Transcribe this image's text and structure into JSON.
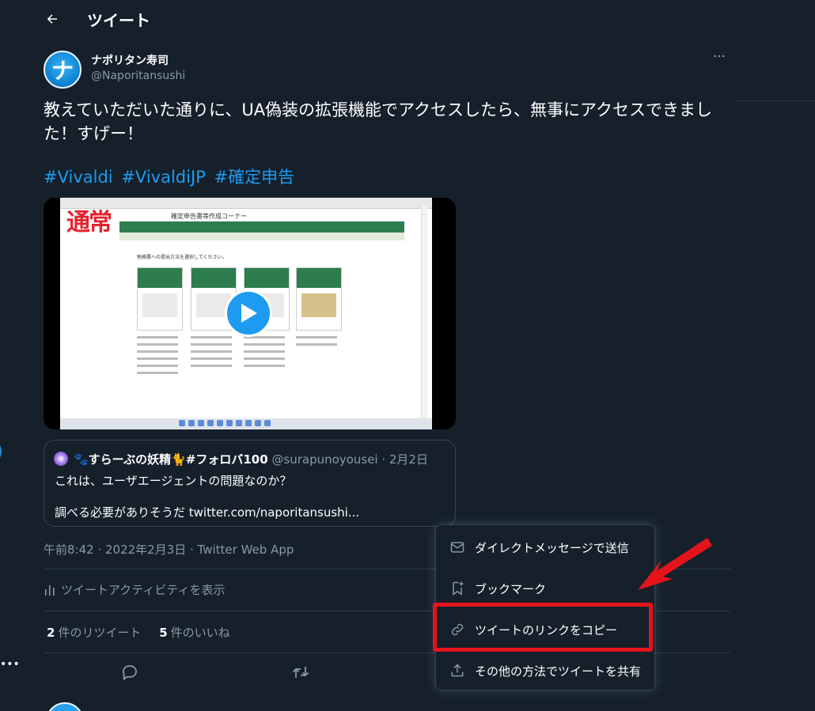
{
  "header": {
    "title": "ツイート",
    "back_icon": "arrow-left-icon"
  },
  "author": {
    "avatar_letter": "ナ",
    "name": "ナポリタン寿司",
    "handle": "@Naporitansushi"
  },
  "tweet": {
    "text": "教えていただいた通りに、UA偽装の拡張機能でアクセスしたら、無事にアクセスできました！すげー！",
    "hashtags": [
      "#Vivaldi",
      "#VivaldiJP",
      "#確定申告"
    ],
    "media_overlay_text": "通常",
    "media_header_title": "確定申告書等作成コーナー",
    "media_section_label": "税務署への提出方法を選択してください。"
  },
  "quote": {
    "name": "🐾すらーぶの妖精🐈#フォロバ100",
    "handle_date": "@surapunoyousei · 2月2日",
    "line1": "これは、ユーザエージェントの問題なのか？",
    "line2": "調べる必要がありそうだ twitter.com/naporitansushi..."
  },
  "meta": {
    "timestamp": "午前8:42 · 2022年2月3日 · Twitter Web App",
    "activity": "ツイートアクティビティを表示",
    "retweets_count": "2",
    "retweets_label": "件のリツイート",
    "likes_count": "5",
    "likes_label": "件のいいね"
  },
  "menu": {
    "items": [
      {
        "label": "ダイレクトメッセージで送信",
        "icon": "envelope-icon"
      },
      {
        "label": "ブックマーク",
        "icon": "bookmark-add-icon"
      },
      {
        "label": "ツイートのリンクをコピー",
        "icon": "link-icon"
      },
      {
        "label": "その他の方法でツイートを共有",
        "icon": "share-icon"
      }
    ]
  },
  "colors": {
    "background": "#15202b",
    "accent": "#1d9bf0",
    "highlight": "#e5141c"
  }
}
